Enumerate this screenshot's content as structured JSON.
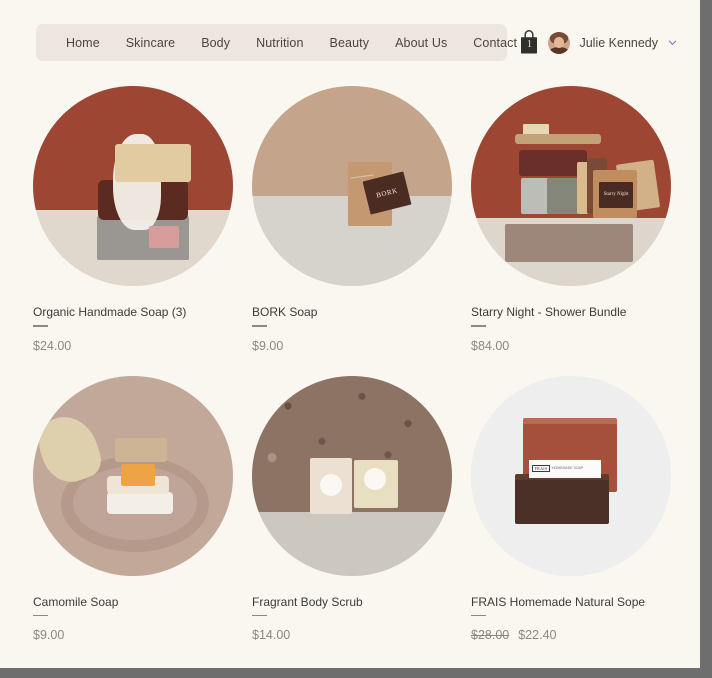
{
  "header": {
    "nav_items": [
      {
        "label": "Home"
      },
      {
        "label": "Skincare"
      },
      {
        "label": "Body"
      },
      {
        "label": "Nutrition"
      },
      {
        "label": "Beauty"
      },
      {
        "label": "About Us"
      },
      {
        "label": "Contact"
      }
    ],
    "cart": {
      "icon": "shopping-bag-icon",
      "count": "1"
    },
    "user": {
      "name": "Julie Kennedy",
      "avatar_icon": "user-avatar",
      "chevron_icon": "chevron-down-icon"
    }
  },
  "colors": {
    "page_background": "#faf6f0",
    "nav_pill": "#ece6de",
    "text_primary": "#3d3a37",
    "text_muted": "#8d8782",
    "accent_terracotta": "#9e4634",
    "chevron": "#7b6fe0",
    "frame": "#6e6e6e"
  },
  "products": [
    {
      "title": "Organic Handmade Soap (3)",
      "price": "$24.00",
      "price_old": null,
      "image_alt": "stacked-soap-bars-with-foam-on-terracotta-background"
    },
    {
      "title": "BORK Soap",
      "price": "$9.00",
      "price_old": null,
      "image_alt": "tan-soap-bar-with-bork-tag",
      "tag_text": "BORK"
    },
    {
      "title": "Starry Night - Shower Bundle",
      "price": "$84.00",
      "price_old": null,
      "image_alt": "shower-bundle-with-brush-and-soaps-on-stone-tray",
      "tag_text": "Starry Night"
    },
    {
      "title": "Camomile Soap",
      "price": "$9.00",
      "price_old": null,
      "image_alt": "soap-bars-stacked-in-ceramic-dish-with-loofah"
    },
    {
      "title": "Fragrant Body Scrub",
      "price": "$14.00",
      "price_old": null,
      "image_alt": "two-wrapped-soaps-against-textured-stone-wall"
    },
    {
      "title": "FRAIS Homemade Natural Sope",
      "price": "$22.40",
      "price_old": "$28.00",
      "image_alt": "two-soap-bars-with-frais-label-on-light-background",
      "label_brand": "FRAIS",
      "label_sub": "HOMEMADE SOAP"
    }
  ]
}
